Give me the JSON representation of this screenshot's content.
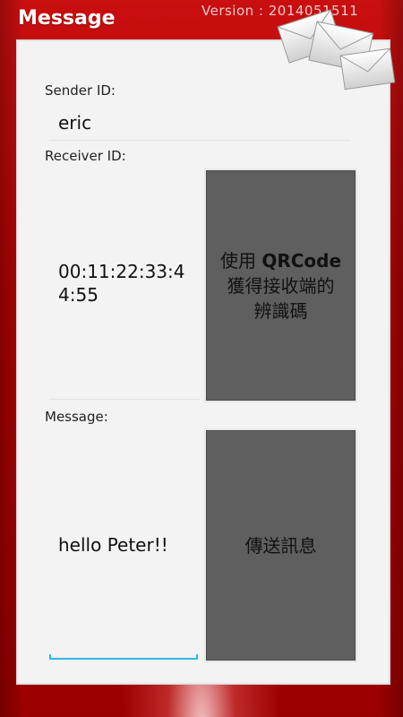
{
  "app": {
    "title": "Message",
    "version": "Version : 2014051511"
  },
  "sender": {
    "label": "Sender ID:",
    "value": "eric"
  },
  "receiver": {
    "label": "Receiver ID:",
    "value_line1": "00:11:22:33:4",
    "value_line2": "4:55",
    "qr_button": {
      "line1_prefix": "使用 ",
      "line1_bold": "QRCode",
      "line2": "獲得接收端的",
      "line3": "辨識碼"
    }
  },
  "message": {
    "label": "Message:",
    "value": "hello Peter!!",
    "send_button": "傳送訊息"
  },
  "colors": {
    "frame_red": "#b10304",
    "panel_bg": "#f3f3f3",
    "button_gray": "#5f5f5f",
    "focus_blue": "#33b5e5"
  },
  "icons": [
    "envelope-stack-icon"
  ]
}
